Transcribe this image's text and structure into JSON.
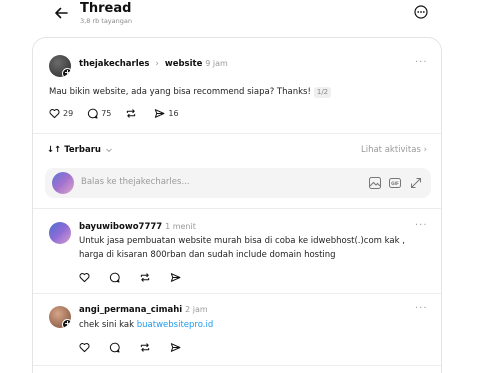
{
  "header": {
    "title": "Thread",
    "views": "3,8 rb tayangan"
  },
  "post": {
    "username": "thejakecharles",
    "separator": "›",
    "community": "website",
    "time": "9 jam",
    "text": "Mau bikin website, ada yang bisa recommend siapa? Thanks!",
    "page_badge": "1/2",
    "likes": "29",
    "comments": "75",
    "shares": "16"
  },
  "sort": {
    "label": "Terbaru",
    "activity": "Lihat aktivitas ›"
  },
  "reply_box": {
    "placeholder": "Balas ke thejakecharles..."
  },
  "replies": [
    {
      "username": "bayuwibowo7777",
      "time": "1 menit",
      "text": "Untuk jasa pembuatan website murah bisa di coba ke idwebhost(.)com kak , harga di kisaran 800rban dan sudah include domain hosting"
    },
    {
      "username": "angi_permana_cimahi",
      "time": "2 jam",
      "text_prefix": "chek sini kak ",
      "link": "buatwebsitepro.id"
    }
  ],
  "colors": {
    "accent_link": "#1d9bf0",
    "muted": "#9a9a9a"
  }
}
